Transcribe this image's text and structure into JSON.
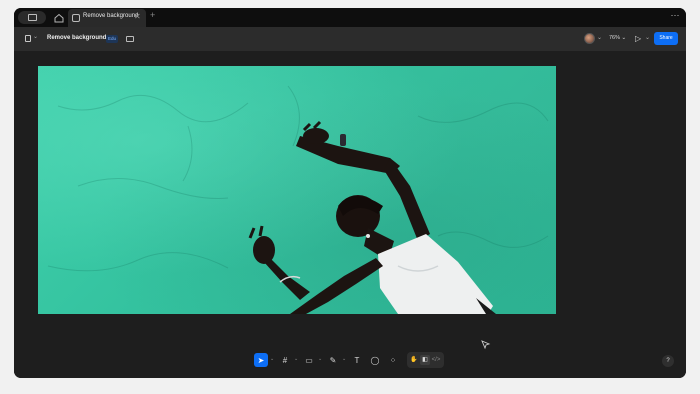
{
  "tabs": {
    "active_label": "Remove background",
    "close_symbol": "✕",
    "new_tab_symbol": "+",
    "window_menu_symbol": "⋯"
  },
  "toolbar": {
    "file_title": "Remove background",
    "plan_badge": "Edu",
    "zoom": "76%",
    "zoom_chevron": "⌄",
    "play_symbol": "▷",
    "play_chevron": "⌄",
    "share_label": "Share"
  },
  "dock": {
    "tools": [
      {
        "name": "move-tool",
        "symbol": "➤",
        "active": true
      },
      {
        "name": "frame-tool",
        "symbol": "#"
      },
      {
        "name": "shape-tool",
        "symbol": "▭"
      },
      {
        "name": "pen-tool",
        "symbol": "✎"
      },
      {
        "name": "text-tool",
        "symbol": "T"
      },
      {
        "name": "comment-tool",
        "symbol": "◯"
      },
      {
        "name": "actions-tool",
        "symbol": "⁘"
      }
    ],
    "modes": [
      "✋",
      "◧",
      "</>"
    ]
  },
  "help_symbol": "?",
  "colors": {
    "accent": "#0d6ef5",
    "canvas_bg": "#1e1e1e",
    "photo_bg": "#3fd0ab"
  }
}
